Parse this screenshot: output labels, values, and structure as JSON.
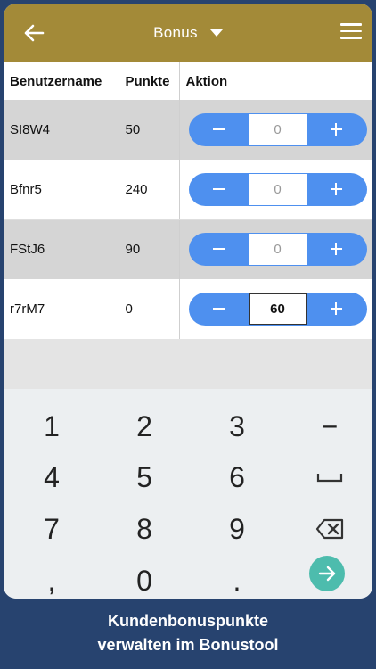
{
  "header": {
    "title": "Bonus",
    "back_icon": "arrow-left-icon",
    "menu_icon": "hamburger-menu-icon",
    "dropdown_icon": "caret-down-icon",
    "color": "#a38a38"
  },
  "table": {
    "columns": [
      "Benutzername",
      "Punkte",
      "Aktion"
    ],
    "rows": [
      {
        "user": "SI8W4",
        "points": "50",
        "amount": "0"
      },
      {
        "user": "Bfnr5",
        "points": "240",
        "amount": "0"
      },
      {
        "user": "FStJ6",
        "points": "90",
        "amount": "0"
      },
      {
        "user": "r7rM7",
        "points": "0",
        "amount": "60"
      }
    ],
    "stepper_color": "#4e90ef"
  },
  "keypad": {
    "keys": [
      "1",
      "2",
      "3",
      "−",
      "4",
      "5",
      "6",
      "␣",
      "7",
      "8",
      "9",
      "⌫",
      ",",
      "0",
      ".",
      "→"
    ],
    "space_icon": "space-bar-icon",
    "backspace_icon": "backspace-icon",
    "go_icon": "arrow-right-circle-icon",
    "go_color": "#4dbcad"
  },
  "caption": {
    "line1": "Kundenbonuspunkte",
    "line2": "verwalten im Bonustool"
  },
  "background_color": "#27436f"
}
